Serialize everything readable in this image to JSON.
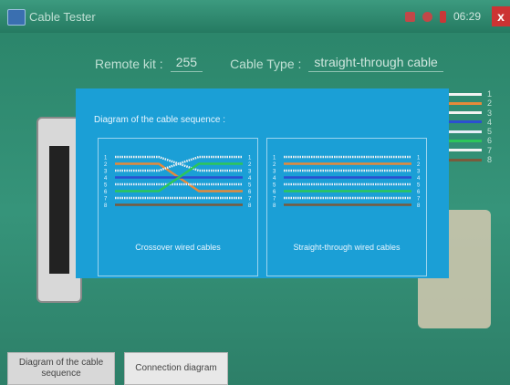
{
  "app": {
    "title": "Cable Tester",
    "time": "06:29",
    "close": "x"
  },
  "info": {
    "remote_kit_label": "Remote kit :",
    "remote_kit_value": "255",
    "cable_type_label": "Cable Type :",
    "cable_type_value": "straight-through cable"
  },
  "dialog": {
    "title": "Diagram of the cable sequence :",
    "crossover_caption": "Crossover wired cables",
    "straight_caption": "Straight-through wired cables",
    "pin_numbers": [
      "1",
      "2",
      "3",
      "4",
      "5",
      "6",
      "7",
      "8"
    ]
  },
  "wire_colors": [
    "#f2f2f2",
    "#e58a3a",
    "#f2f2f2",
    "#2b4fd1",
    "#e8eef8",
    "#2cc65a",
    "#f2f2f2",
    "#7a5a3c"
  ],
  "crossover_map": [
    3,
    6,
    1,
    4,
    5,
    2,
    7,
    8
  ],
  "right_side": {
    "numbers": [
      "1",
      "2",
      "3",
      "4",
      "5",
      "6",
      "7",
      "8"
    ]
  },
  "buttons": {
    "sequence_label": "Diagram of the cable sequence",
    "connection_label": "Connection diagram"
  }
}
